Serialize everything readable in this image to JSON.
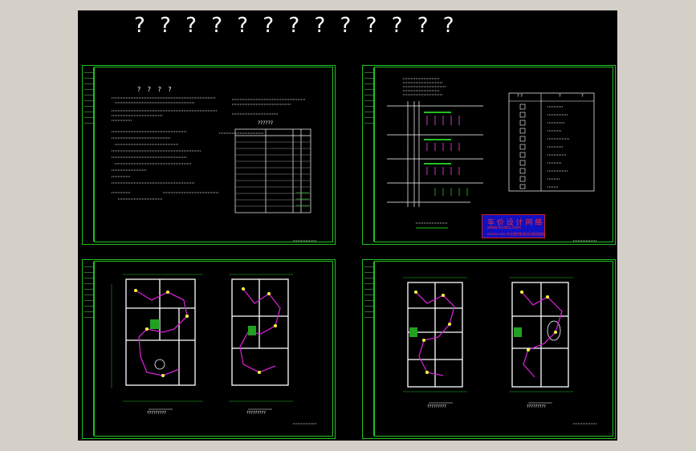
{
  "viewport": {
    "background": "#000000"
  },
  "drawing_title": "? ? ? ? ? ? ? ? ? ? ? ? ?",
  "colors": {
    "frame": "#22c022",
    "text": "#ffffff",
    "wiring": "#d020d0",
    "walls": "#ffffff",
    "dimension": "#22c022",
    "fixtures": "#ffff40",
    "stamp_bg": "#1010c0",
    "stamp_text": "#ff3030"
  },
  "sheets": [
    {
      "id": "design-notes",
      "heading": "? ? ? ?",
      "table_title": "??????"
    },
    {
      "id": "system-diagram",
      "legend_headers": [
        "? ?",
        "?",
        "?"
      ]
    },
    {
      "id": "floor-plans-1",
      "caption_left": "?????????",
      "caption_right": "?????????"
    },
    {
      "id": "floor-plans-2",
      "caption_left": "?????????",
      "caption_right": "?????????"
    }
  ],
  "stamp": {
    "line1": "车 价 设 计 网 络",
    "line2": "www.mcdcc.com",
    "line3": "mcdcc.com 专业提供各类设计图纸服务"
  }
}
